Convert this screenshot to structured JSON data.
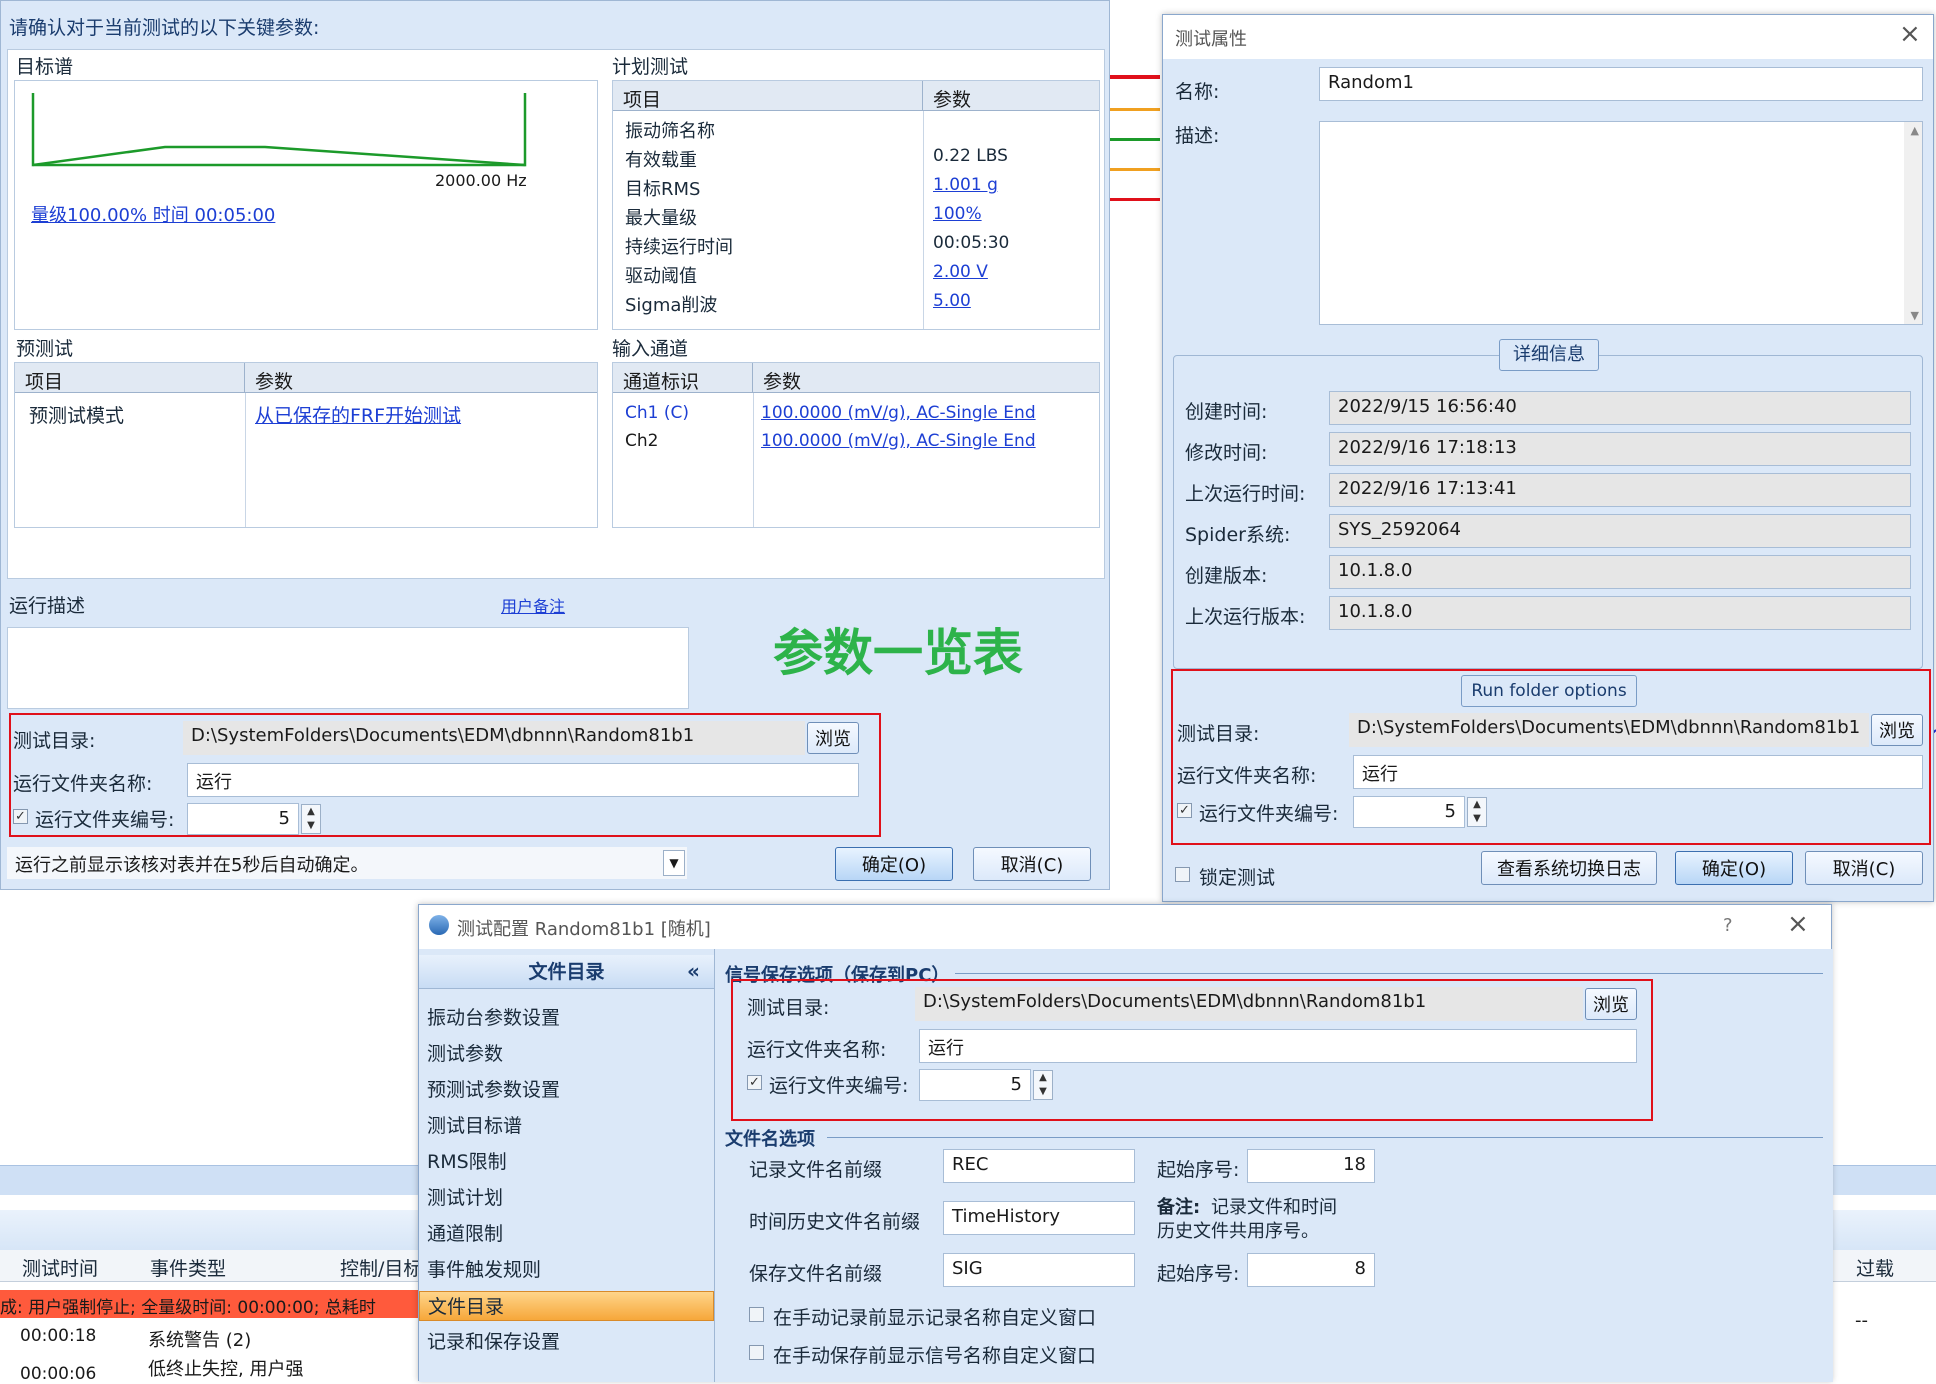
{
  "dialog_left": {
    "header": "请确认对于当前测试的以下关键参数:",
    "target_title": "目标谱",
    "freq_label": "2000.00 Hz",
    "level_link": "量级100.00% 时间 00:05:00",
    "plan_title": "计划测试",
    "plan_col1": "项目",
    "plan_col2": "参数",
    "plan_rows": [
      {
        "k": "振动筛名称",
        "v": ""
      },
      {
        "k": "有效载重",
        "v": "0.22 LBS"
      },
      {
        "k": "目标RMS",
        "v": "1.001 g"
      },
      {
        "k": "最大量级",
        "v": "100%"
      },
      {
        "k": "持续运行时间",
        "v": "00:05:30"
      },
      {
        "k": "驱动阈值",
        "v": "2.00 V"
      },
      {
        "k": "Sigma削波",
        "v": "5.00"
      }
    ],
    "pretest_title": "预测试",
    "pre_col1": "项目",
    "pre_col2": "参数",
    "pre_k": "预测试模式",
    "pre_v": "从已保存的FRF开始测试",
    "input_title": "输入通道",
    "in_col1": "通道标识",
    "in_col2": "参数",
    "channels": [
      {
        "k": "Ch1 (C)",
        "v": "100.0000 (mV/g), AC-Single End"
      },
      {
        "k": "Ch2",
        "v": "100.0000 (mV/g), AC-Single End"
      }
    ],
    "run_desc": "运行描述",
    "user_note": "用户备注",
    "big_title": "参数一览表",
    "dir_label": "测试目录:",
    "dir_value": "D:\\SystemFolders\\Documents\\EDM\\dbnnn\\Random81b1",
    "browse": "浏览",
    "folder_label": "运行文件夹名称:",
    "folder_value": "运行",
    "num_label": "运行文件夹编号:",
    "num_value": "5",
    "bottom_select": "运行之前显示该核对表并在5秒后自动确定。",
    "ok": "确定(O)",
    "cancel": "取消(C)"
  },
  "dialog_props": {
    "title": "测试属性",
    "name_label": "名称:",
    "name_value": "Random1",
    "desc_label": "描述:",
    "detail_title": "详细信息",
    "details": [
      {
        "k": "创建时间:",
        "v": "2022/9/15 16:56:40"
      },
      {
        "k": "修改时间:",
        "v": "2022/9/16 17:18:13"
      },
      {
        "k": "上次运行时间:",
        "v": "2022/9/16 17:13:41"
      },
      {
        "k": "Spider系统:",
        "v": "SYS_2592064"
      },
      {
        "k": "创建版本:",
        "v": "10.1.8.0"
      },
      {
        "k": "上次运行版本:",
        "v": "10.1.8.0"
      }
    ],
    "run_folder_title": "Run folder options",
    "dir_label": "测试目录:",
    "dir_value": "D:\\SystemFolders\\Documents\\EDM\\dbnnn\\Random81b1",
    "browse": "浏览",
    "folder_label": "运行文件夹名称:",
    "folder_value": "运行",
    "num_label": "运行文件夹编号:",
    "num_value": "5",
    "lock": "锁定测试",
    "log_btn": "查看系统切换日志",
    "ok": "确定(O)",
    "cancel": "取消(C)"
  },
  "dialog_config": {
    "title": "测试配置 Random81b1 [随机]",
    "help": "?",
    "nav_header": "文件目录",
    "nav_items": [
      "振动台参数设置",
      "测试参数",
      "预测试参数设置",
      "测试目标谱",
      "RMS限制",
      "测试计划",
      "通道限制",
      "事件触发规则",
      "文件目录",
      "记录和保存设置"
    ],
    "active_nav": "文件目录",
    "sig_section": "信号保存选项（保存到PC）",
    "dir_label": "测试目录:",
    "dir_value": "D:\\SystemFolders\\Documents\\EDM\\dbnnn\\Random81b1",
    "browse": "浏览",
    "folder_label": "运行文件夹名称:",
    "folder_value": "运行",
    "num_label": "运行文件夹编号:",
    "num_value": "5",
    "file_section": "文件名选项",
    "rec_label": "记录文件名前缀",
    "rec_value": "REC",
    "start_label": "起始序号:",
    "start_value": "18",
    "th_label": "时间历史文件名前缀",
    "th_value": "TimeHistory",
    "note_bold": "备注:",
    "note_text": "记录文件和时间",
    "note_text2": "历史文件共用序号。",
    "sig_label": "保存文件名前缀",
    "sig_value": "SIG",
    "start2_label": "起始序号:",
    "start2_value": "8",
    "chk1": "在手动记录前显示记录名称自定义窗口",
    "chk2": "在手动保存前显示信号名称自定义窗口"
  },
  "background": {
    "col_time": "测试时间",
    "col_type": "事件类型",
    "col_ctrl": "控制/目标",
    "col_over": "过载",
    "alert": "成:  用户强制停止; 全量级时间: 00:00:00; 总耗时",
    "row1_time": "00:00:18",
    "row1_type": "系统警告 (2)",
    "row2_time": "00:00:06",
    "row2_type": "低终止失控, 用户强",
    "dash": "--"
  },
  "colors": {
    "red_box": "#e0101a",
    "title_green": "#2db34a",
    "link": "#1d3fd4",
    "alert": "#ff5a3c"
  }
}
